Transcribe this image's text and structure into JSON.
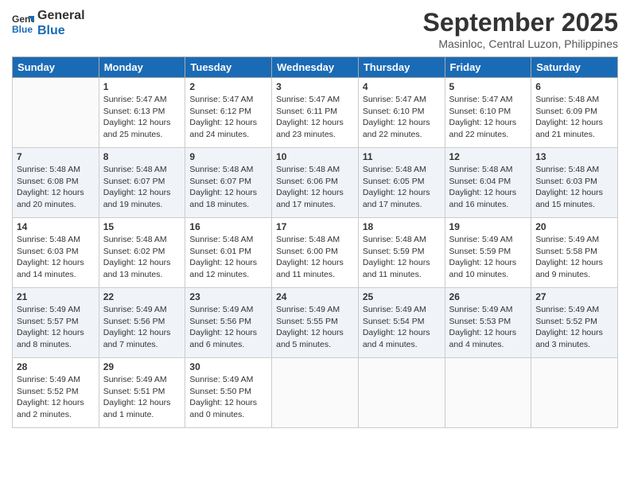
{
  "header": {
    "logo_line1": "General",
    "logo_line2": "Blue",
    "month": "September 2025",
    "location": "Masinloc, Central Luzon, Philippines"
  },
  "weekdays": [
    "Sunday",
    "Monday",
    "Tuesday",
    "Wednesday",
    "Thursday",
    "Friday",
    "Saturday"
  ],
  "weeks": [
    [
      {
        "day": "",
        "info": ""
      },
      {
        "day": "1",
        "info": "Sunrise: 5:47 AM\nSunset: 6:13 PM\nDaylight: 12 hours\nand 25 minutes."
      },
      {
        "day": "2",
        "info": "Sunrise: 5:47 AM\nSunset: 6:12 PM\nDaylight: 12 hours\nand 24 minutes."
      },
      {
        "day": "3",
        "info": "Sunrise: 5:47 AM\nSunset: 6:11 PM\nDaylight: 12 hours\nand 23 minutes."
      },
      {
        "day": "4",
        "info": "Sunrise: 5:47 AM\nSunset: 6:10 PM\nDaylight: 12 hours\nand 22 minutes."
      },
      {
        "day": "5",
        "info": "Sunrise: 5:47 AM\nSunset: 6:10 PM\nDaylight: 12 hours\nand 22 minutes."
      },
      {
        "day": "6",
        "info": "Sunrise: 5:48 AM\nSunset: 6:09 PM\nDaylight: 12 hours\nand 21 minutes."
      }
    ],
    [
      {
        "day": "7",
        "info": "Sunrise: 5:48 AM\nSunset: 6:08 PM\nDaylight: 12 hours\nand 20 minutes."
      },
      {
        "day": "8",
        "info": "Sunrise: 5:48 AM\nSunset: 6:07 PM\nDaylight: 12 hours\nand 19 minutes."
      },
      {
        "day": "9",
        "info": "Sunrise: 5:48 AM\nSunset: 6:07 PM\nDaylight: 12 hours\nand 18 minutes."
      },
      {
        "day": "10",
        "info": "Sunrise: 5:48 AM\nSunset: 6:06 PM\nDaylight: 12 hours\nand 17 minutes."
      },
      {
        "day": "11",
        "info": "Sunrise: 5:48 AM\nSunset: 6:05 PM\nDaylight: 12 hours\nand 17 minutes."
      },
      {
        "day": "12",
        "info": "Sunrise: 5:48 AM\nSunset: 6:04 PM\nDaylight: 12 hours\nand 16 minutes."
      },
      {
        "day": "13",
        "info": "Sunrise: 5:48 AM\nSunset: 6:03 PM\nDaylight: 12 hours\nand 15 minutes."
      }
    ],
    [
      {
        "day": "14",
        "info": "Sunrise: 5:48 AM\nSunset: 6:03 PM\nDaylight: 12 hours\nand 14 minutes."
      },
      {
        "day": "15",
        "info": "Sunrise: 5:48 AM\nSunset: 6:02 PM\nDaylight: 12 hours\nand 13 minutes."
      },
      {
        "day": "16",
        "info": "Sunrise: 5:48 AM\nSunset: 6:01 PM\nDaylight: 12 hours\nand 12 minutes."
      },
      {
        "day": "17",
        "info": "Sunrise: 5:48 AM\nSunset: 6:00 PM\nDaylight: 12 hours\nand 11 minutes."
      },
      {
        "day": "18",
        "info": "Sunrise: 5:48 AM\nSunset: 5:59 PM\nDaylight: 12 hours\nand 11 minutes."
      },
      {
        "day": "19",
        "info": "Sunrise: 5:49 AM\nSunset: 5:59 PM\nDaylight: 12 hours\nand 10 minutes."
      },
      {
        "day": "20",
        "info": "Sunrise: 5:49 AM\nSunset: 5:58 PM\nDaylight: 12 hours\nand 9 minutes."
      }
    ],
    [
      {
        "day": "21",
        "info": "Sunrise: 5:49 AM\nSunset: 5:57 PM\nDaylight: 12 hours\nand 8 minutes."
      },
      {
        "day": "22",
        "info": "Sunrise: 5:49 AM\nSunset: 5:56 PM\nDaylight: 12 hours\nand 7 minutes."
      },
      {
        "day": "23",
        "info": "Sunrise: 5:49 AM\nSunset: 5:56 PM\nDaylight: 12 hours\nand 6 minutes."
      },
      {
        "day": "24",
        "info": "Sunrise: 5:49 AM\nSunset: 5:55 PM\nDaylight: 12 hours\nand 5 minutes."
      },
      {
        "day": "25",
        "info": "Sunrise: 5:49 AM\nSunset: 5:54 PM\nDaylight: 12 hours\nand 4 minutes."
      },
      {
        "day": "26",
        "info": "Sunrise: 5:49 AM\nSunset: 5:53 PM\nDaylight: 12 hours\nand 4 minutes."
      },
      {
        "day": "27",
        "info": "Sunrise: 5:49 AM\nSunset: 5:52 PM\nDaylight: 12 hours\nand 3 minutes."
      }
    ],
    [
      {
        "day": "28",
        "info": "Sunrise: 5:49 AM\nSunset: 5:52 PM\nDaylight: 12 hours\nand 2 minutes."
      },
      {
        "day": "29",
        "info": "Sunrise: 5:49 AM\nSunset: 5:51 PM\nDaylight: 12 hours\nand 1 minute."
      },
      {
        "day": "30",
        "info": "Sunrise: 5:49 AM\nSunset: 5:50 PM\nDaylight: 12 hours\nand 0 minutes."
      },
      {
        "day": "",
        "info": ""
      },
      {
        "day": "",
        "info": ""
      },
      {
        "day": "",
        "info": ""
      },
      {
        "day": "",
        "info": ""
      }
    ]
  ]
}
